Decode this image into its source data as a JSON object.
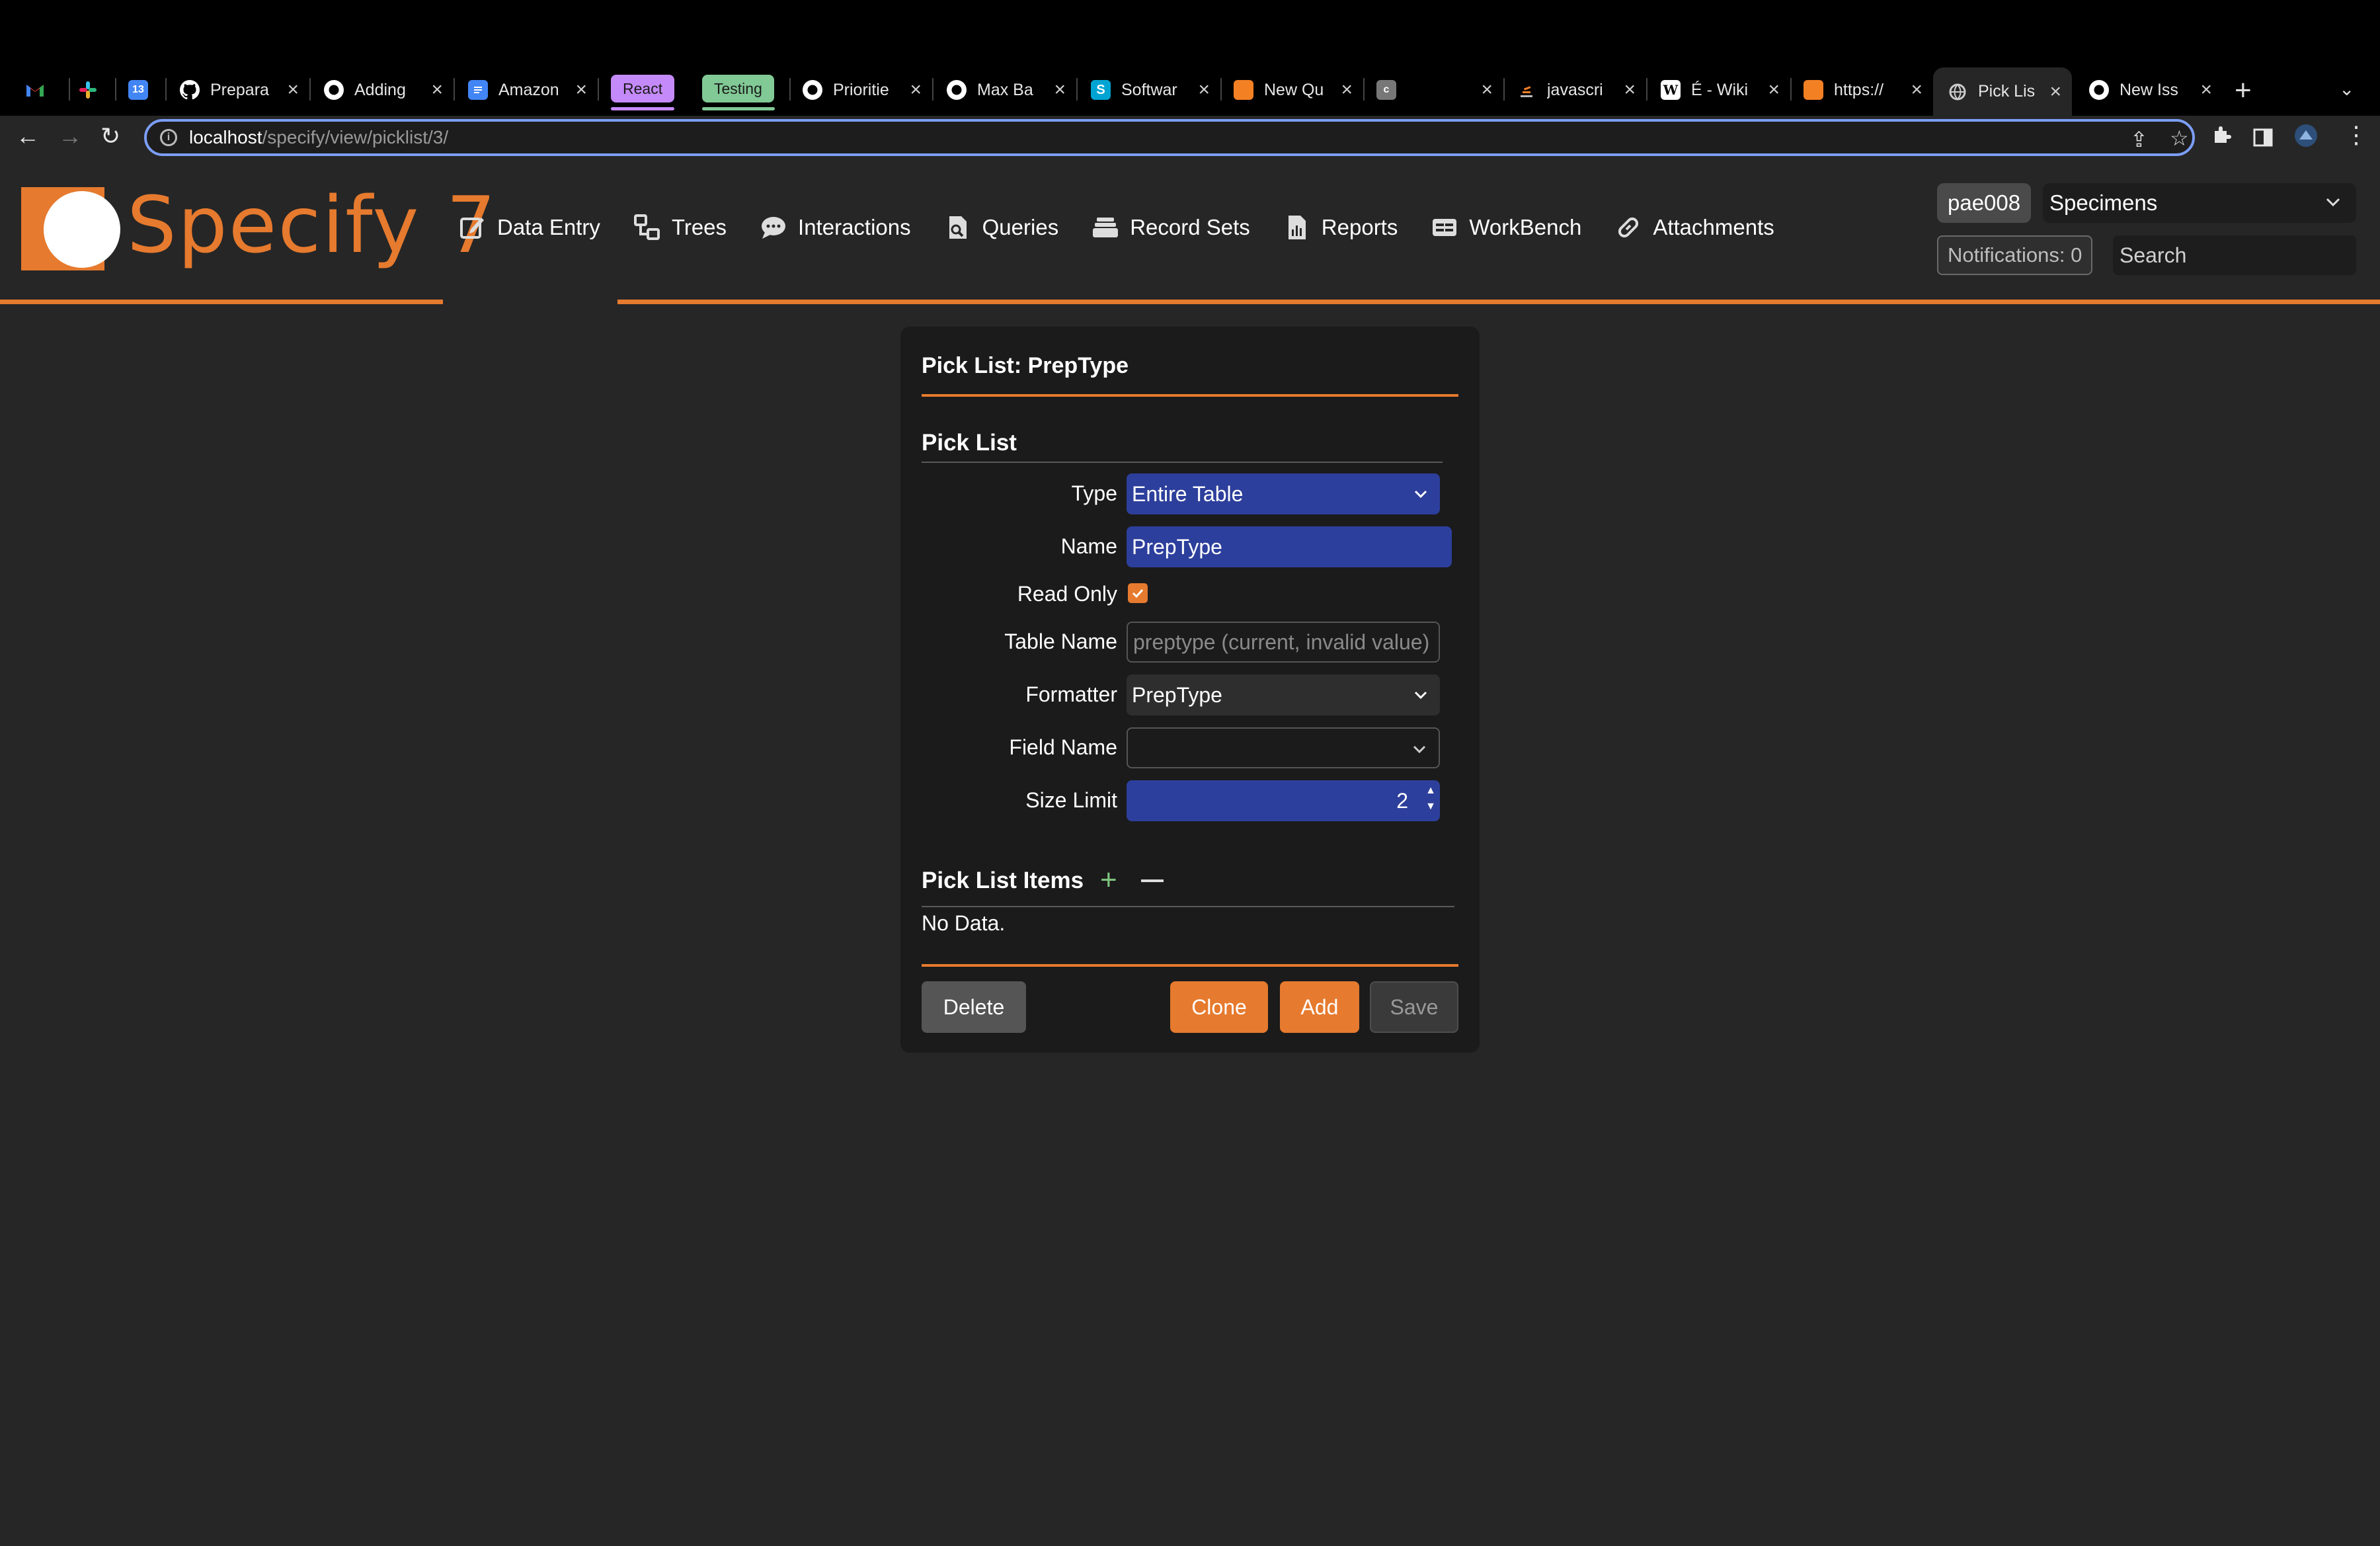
{
  "browser": {
    "tabs": [
      {
        "title": "",
        "icon": "gmail-icon",
        "color": "#ea4335"
      },
      {
        "title": "",
        "icon": "slack-icon",
        "color": "#e01e5a"
      },
      {
        "title": "",
        "icon": "calendar-icon",
        "color": "#4285f4",
        "glyph": "13"
      },
      {
        "title": "Prepara",
        "icon": "github-icon"
      },
      {
        "title": "Adding",
        "icon": "github-icon"
      },
      {
        "title": "Amazon",
        "icon": "docs-icon",
        "color": "#4285f4"
      },
      {
        "title": "Prioritie",
        "icon": "github-icon"
      },
      {
        "title": "Max Ba",
        "icon": "github-icon"
      },
      {
        "title": "Softwar",
        "icon": "sourcegraph-icon",
        "color": "#00a4d3"
      },
      {
        "title": "New Qu",
        "icon": "stackoverflow-icon",
        "color": "#f48024"
      },
      {
        "title": "",
        "icon": "c-icon",
        "color": "#777",
        "glyph": "c"
      },
      {
        "title": "javascri",
        "icon": "stackoverflow-icon",
        "color": "#f48024"
      },
      {
        "title": "É - Wiki",
        "icon": "wikipedia-icon",
        "color": "#ffffff",
        "glyph": "W"
      },
      {
        "title": "https://",
        "icon": "stackoverflow-icon",
        "color": "#f48024"
      },
      {
        "title": "Pick Lis",
        "icon": "globe-icon"
      },
      {
        "title": "New Iss",
        "icon": "github-icon"
      }
    ],
    "groups": [
      {
        "label": "React",
        "color": "#c58af9"
      },
      {
        "label": "Testing",
        "color": "#81c995"
      }
    ],
    "url_host": "localhost",
    "url_path": "/specify/view/picklist/3/"
  },
  "header": {
    "logo_text": "Specify 7",
    "menu": [
      {
        "label": "Data Entry",
        "icon": "edit-icon"
      },
      {
        "label": "Trees",
        "icon": "tree-icon"
      },
      {
        "label": "Interactions",
        "icon": "chat-icon"
      },
      {
        "label": "Queries",
        "icon": "query-icon"
      },
      {
        "label": "Record Sets",
        "icon": "stack-icon"
      },
      {
        "label": "Reports",
        "icon": "report-icon"
      },
      {
        "label": "WorkBench",
        "icon": "table-icon"
      },
      {
        "label": "Attachments",
        "icon": "link-icon"
      }
    ],
    "user": "pae008",
    "collection": "Specimens",
    "notifications": "Notifications: 0",
    "search_placeholder": "Search",
    "accent": "#e67a2e"
  },
  "form": {
    "title": "Pick List: PrepType",
    "section_title": "Pick List",
    "fields": {
      "type": {
        "label": "Type",
        "value": "Entire Table"
      },
      "name": {
        "label": "Name",
        "value": "PrepType"
      },
      "read_only": {
        "label": "Read Only",
        "checked": true
      },
      "table_name": {
        "label": "Table Name",
        "placeholder": "preptype (current, invalid value)"
      },
      "formatter": {
        "label": "Formatter",
        "value": "PrepType"
      },
      "field_name": {
        "label": "Field Name",
        "value": ""
      },
      "size_limit": {
        "label": "Size Limit",
        "value": "2"
      }
    },
    "items_title": "Pick List Items",
    "items_empty": "No Data.",
    "buttons": {
      "delete": "Delete",
      "clone": "Clone",
      "add": "Add",
      "save": "Save"
    }
  }
}
